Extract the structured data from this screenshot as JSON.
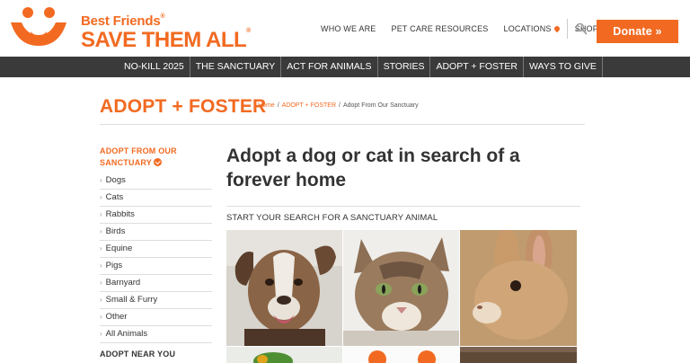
{
  "brand": {
    "small": "Best Friends",
    "big": "SAVE THEM ALL",
    "reg": "®",
    "colors": {
      "orange": "#f26a21",
      "nav_bg": "#3a3a3a"
    }
  },
  "topnav": {
    "items": [
      "WHO WE ARE",
      "PET CARE RESOURCES",
      "LOCATIONS",
      "SHOP"
    ],
    "search_icon": "search-icon",
    "location_icon": "map-pin-icon"
  },
  "donate": {
    "label": "Donate »"
  },
  "mainnav": {
    "items": [
      "NO-KILL 2025",
      "THE SANCTUARY",
      "ACT FOR ANIMALS",
      "STORIES",
      "ADOPT + FOSTER",
      "WAYS TO GIVE"
    ]
  },
  "page": {
    "title": "ADOPT + FOSTER",
    "breadcrumb": [
      "Home",
      "ADOPT + FOSTER",
      "Adopt From Our Sanctuary"
    ],
    "breadcrumb_sep": "/"
  },
  "sidebar": {
    "heading_line1": "ADOPT FROM OUR",
    "heading_line2": "SANCTUARY",
    "items": [
      "Dogs",
      "Cats",
      "Rabbits",
      "Birds",
      "Equine",
      "Pigs",
      "Barnyard",
      "Small & Furry",
      "Other",
      "All Animals"
    ],
    "chevron": "›",
    "heading2": "ADOPT NEAR YOU"
  },
  "content": {
    "heading": "Adopt a dog or cat in search of a forever home",
    "subhead": "START YOUR SEARCH FOR A SANCTUARY ANIMAL",
    "tiles": [
      "dog-photo",
      "cat-photo",
      "rabbit-photo",
      "bird-photo",
      "pig-photo",
      "horse-photo"
    ]
  }
}
